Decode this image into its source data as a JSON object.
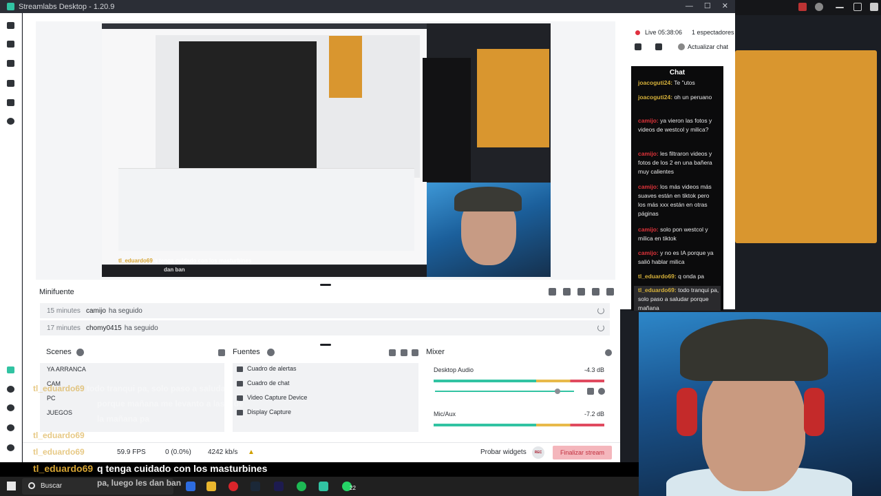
{
  "window": {
    "title": "Streamlabs Desktop - 1.20.9",
    "min": "—",
    "max": "☐",
    "close": "✕"
  },
  "preview": {
    "overlay_user": "tl_eduardo69",
    "overlay_msg": "q tenga cuidado con los masturbines",
    "overlay_sub": "dan ban"
  },
  "minifuente": {
    "title": "Minifuente",
    "events": [
      {
        "time": "15 minutes",
        "user": "camijo",
        "action": "ha seguido"
      },
      {
        "time": "17 minutes",
        "user": "chomy0415",
        "action": "ha seguido"
      }
    ]
  },
  "scenes": {
    "title": "Scenes",
    "items": [
      "YA ARRANCA",
      "CAM",
      "PC",
      "JUEGOS"
    ]
  },
  "sources": {
    "title": "Fuentes",
    "items": [
      "Cuadro de alertas",
      "Cuadro de chat",
      "Video Capture Device",
      "Display Capture"
    ]
  },
  "mixer": {
    "title": "Mixer",
    "channels": [
      {
        "name": "Desktop Audio",
        "db": "-4.3 dB"
      },
      {
        "name": "Mic/Aux",
        "db": "-7.2 dB"
      }
    ]
  },
  "footer": {
    "fps": "59.9 FPS",
    "dropped": "0 (0.0%)",
    "bitrate": "4242 kb/s",
    "test_widgets": "Probar widgets",
    "rec": "REC",
    "end_stream": "Finalizar stream"
  },
  "chat_dock": {
    "live": "Live 05:38:06",
    "viewers": "1 espectadores",
    "refresh": "Actualizar chat",
    "chat_title": "Chat",
    "messages": [
      {
        "user": "joacoguti24:",
        "text": "Te \"utos",
        "partial": true
      },
      {
        "user": "joacoguti24:",
        "text": "oh un peruano"
      },
      {
        "user": "camijo:",
        "text": "ya vieron las fotos y videos de westcol y milica?"
      },
      {
        "user": "camijo:",
        "text": "les filtraron videos y fotos de los 2 en una bañera muy calientes"
      },
      {
        "user": "camijo:",
        "text": "los más videos más suaves están en tiktok pero los más xxx están en otras páginas"
      },
      {
        "user": "camijo:",
        "text": "solo pon westcol y milica en tiktok"
      },
      {
        "user": "camijo:",
        "text": "y no es IA porque ya salió hablar milica"
      },
      {
        "user": "tl_eduardo69:",
        "text": "q onda pa"
      },
      {
        "user": "tl_eduardo69:",
        "text": "todo tranqui pa, solo paso a saludar porque mañana"
      }
    ]
  },
  "stream_overlay": {
    "lines": [
      {
        "user": "tl_eduardo69",
        "text": "todo tranqui pa, solo paso a saludar"
      },
      {
        "user": "",
        "text": "porque mañana me levanto a las 5 de"
      },
      {
        "user": "",
        "text": "la mañana pa"
      },
      {
        "user": "tl_eduardo69",
        "text": "andaba haciendo unas rolas pa"
      },
      {
        "user": "tl_eduardo69",
        "text": "es"
      }
    ],
    "main_user": "tl_eduardo69",
    "main_msg": "q tenga cuidado con los masturbines",
    "tail": "pa, luego les dan ban"
  },
  "taskbar": {
    "search": "Buscar",
    "badge": "22"
  },
  "colors": {
    "accent": "#31c3a2",
    "live": "#e0303f",
    "username_chat": "#e0333a",
    "overlay_user": "#d7a533",
    "end_stream_bg": "#f4b6bc"
  }
}
